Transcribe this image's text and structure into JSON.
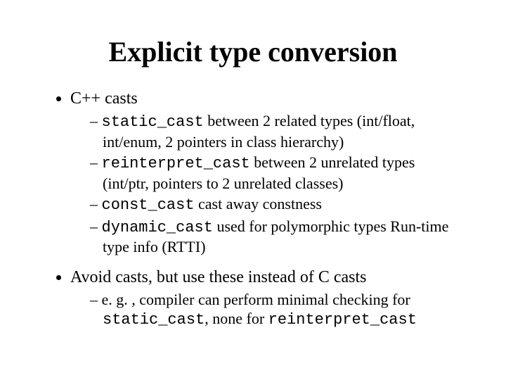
{
  "title": "Explicit type conversion",
  "bullet1": {
    "label": "C++ casts"
  },
  "sub1": {
    "a_code": "static_cast",
    "a_rest": "  between 2 related types (int/float, int/enum, 2 pointers in class hierarchy)",
    "b_code": "reinterpret_cast",
    "b_rest": "  between 2 unrelated types (int/ptr, pointers to 2 unrelated classes)",
    "c_code": "const_cast",
    "c_rest": "  cast away constness",
    "d_code": "dynamic_cast",
    "d_rest": "  used for polymorphic types Run-time type info (RTTI)"
  },
  "bullet2": {
    "label": "Avoid casts, but use these instead of C casts"
  },
  "sub2": {
    "a_pre": "e. g. , compiler can perform minimal checking for ",
    "a_code1": "static_cast",
    "a_mid": ", none for ",
    "a_code2": "reinterpret_cast"
  }
}
